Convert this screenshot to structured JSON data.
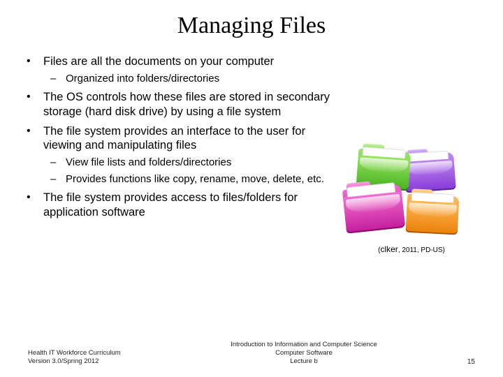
{
  "title": "Managing Files",
  "bullets": [
    {
      "text": "Files are all the documents on your computer",
      "children": [
        {
          "text": "Organized into folders/directories"
        }
      ]
    },
    {
      "text": "The OS controls how these files are stored in secondary storage (hard disk drive) by using a file system"
    },
    {
      "text": "The file system provides an interface to the user for viewing and manipulating files",
      "children": [
        {
          "text": "View file lists and folders/directories"
        },
        {
          "text": "Provides functions like copy, rename, move, delete, etc."
        }
      ]
    },
    {
      "text": "The file system provides access to files/folders for application software"
    }
  ],
  "image_caption": {
    "prefix": "(",
    "source": "clker",
    "suffix": ", 2011, PD-US)"
  },
  "footer": {
    "left_line1": "Health IT Workforce Curriculum",
    "left_line2": "Version 3.0/Spring 2012",
    "center_line1": "Introduction to Information and Computer Science",
    "center_line2": "Computer Software",
    "center_line3": "Lecture b",
    "page": "15"
  }
}
